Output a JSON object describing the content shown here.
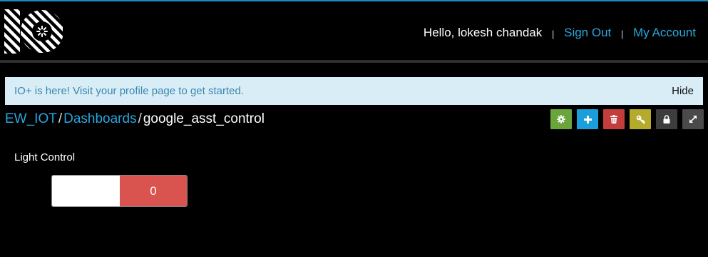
{
  "header": {
    "greeting": "Hello, lokesh chandak",
    "separator": "|",
    "sign_out": "Sign Out",
    "my_account": "My Account",
    "accent_color": "#2aa6de"
  },
  "notice": {
    "prefix": "IO+ is here! Visit ",
    "link": "your profile page",
    "suffix": " to get started.",
    "hide": "Hide"
  },
  "breadcrumb": {
    "root": "EW_IOT",
    "section": "Dashboards",
    "current": "google_asst_control",
    "separator": "/"
  },
  "toolbar": {
    "buttons": [
      {
        "name": "settings",
        "icon": "gear-icon",
        "color": "#6aa53b"
      },
      {
        "name": "add-block",
        "icon": "plus-icon",
        "color": "#1a9fdb"
      },
      {
        "name": "delete",
        "icon": "trash-icon",
        "color": "#c33d3d"
      },
      {
        "name": "key",
        "icon": "key-icon",
        "color": "#b4aa2c"
      },
      {
        "name": "lock",
        "icon": "lock-icon",
        "color": "#3c3c3c"
      },
      {
        "name": "fullscreen",
        "icon": "expand-icon",
        "color": "#4a4a4a"
      }
    ]
  },
  "widget": {
    "title": "Light Control",
    "value": "0",
    "off_color": "#ffffff",
    "on_color": "#d9534f"
  }
}
